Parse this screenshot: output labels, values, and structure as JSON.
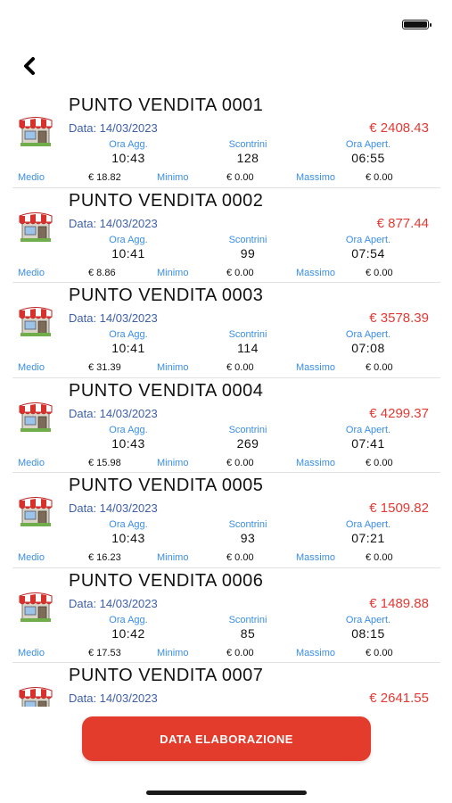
{
  "nav": {
    "back_icon": "chevron-left-icon"
  },
  "status": {
    "battery_icon": "battery-icon"
  },
  "stores": [
    {
      "name": "PUNTO VENDITA 0001",
      "date": "Data: 14/03/2023",
      "total": "€ 2408.43",
      "ora_agg_label": "Ora Agg.",
      "ora_agg": "10:43",
      "scontrini_label": "Scontrini",
      "scontrini": "128",
      "ora_apert_label": "Ora Apert.",
      "ora_apert": "06:55",
      "medio_label": "Medio",
      "medio": "€ 18.82",
      "minimo_label": "Minimo",
      "minimo": "€ 0.00",
      "massimo_label": "Massimo",
      "massimo": "€ 0.00"
    },
    {
      "name": "PUNTO VENDITA 0002",
      "date": "Data: 14/03/2023",
      "total": "€ 877.44",
      "ora_agg_label": "Ora Agg.",
      "ora_agg": "10:41",
      "scontrini_label": "Scontrini",
      "scontrini": "99",
      "ora_apert_label": "Ora Apert.",
      "ora_apert": "07:54",
      "medio_label": "Medio",
      "medio": "€ 8.86",
      "minimo_label": "Minimo",
      "minimo": "€ 0.00",
      "massimo_label": "Massimo",
      "massimo": "€ 0.00"
    },
    {
      "name": "PUNTO VENDITA 0003",
      "date": "Data: 14/03/2023",
      "total": "€ 3578.39",
      "ora_agg_label": "Ora Agg.",
      "ora_agg": "10:41",
      "scontrini_label": "Scontrini",
      "scontrini": "114",
      "ora_apert_label": "Ora Apert.",
      "ora_apert": "07:08",
      "medio_label": "Medio",
      "medio": "€ 31.39",
      "minimo_label": "Minimo",
      "minimo": "€ 0.00",
      "massimo_label": "Massimo",
      "massimo": "€ 0.00"
    },
    {
      "name": "PUNTO VENDITA 0004",
      "date": "Data: 14/03/2023",
      "total": "€ 4299.37",
      "ora_agg_label": "Ora Agg.",
      "ora_agg": "10:43",
      "scontrini_label": "Scontrini",
      "scontrini": "269",
      "ora_apert_label": "Ora Apert.",
      "ora_apert": "07:41",
      "medio_label": "Medio",
      "medio": "€ 15.98",
      "minimo_label": "Minimo",
      "minimo": "€ 0.00",
      "massimo_label": "Massimo",
      "massimo": "€ 0.00"
    },
    {
      "name": "PUNTO VENDITA 0005",
      "date": "Data: 14/03/2023",
      "total": "€ 1509.82",
      "ora_agg_label": "Ora Agg.",
      "ora_agg": "10:43",
      "scontrini_label": "Scontrini",
      "scontrini": "93",
      "ora_apert_label": "Ora Apert.",
      "ora_apert": "07:21",
      "medio_label": "Medio",
      "medio": "€ 16.23",
      "minimo_label": "Minimo",
      "minimo": "€ 0.00",
      "massimo_label": "Massimo",
      "massimo": "€ 0.00"
    },
    {
      "name": "PUNTO VENDITA 0006",
      "date": "Data: 14/03/2023",
      "total": "€ 1489.88",
      "ora_agg_label": "Ora Agg.",
      "ora_agg": "10:42",
      "scontrini_label": "Scontrini",
      "scontrini": "85",
      "ora_apert_label": "Ora Apert.",
      "ora_apert": "08:15",
      "medio_label": "Medio",
      "medio": "€ 17.53",
      "minimo_label": "Minimo",
      "minimo": "€ 0.00",
      "massimo_label": "Massimo",
      "massimo": "€ 0.00"
    },
    {
      "name": "PUNTO VENDITA 0007",
      "date": "Data: 14/03/2023",
      "total": "€ 2641.55",
      "ora_agg_label": "",
      "ora_agg": "",
      "scontrini_label": "",
      "scontrini": "",
      "ora_apert_label": "",
      "ora_apert": "",
      "medio_label": "",
      "medio": "",
      "minimo_label": "",
      "minimo": "",
      "massimo_label": "",
      "massimo": ""
    }
  ],
  "action": {
    "label": "DATA ELABORAZIONE"
  },
  "colors": {
    "accent_red": "#e33c2c",
    "total_red": "#e23a34",
    "label_blue": "#3a8ee6",
    "date_blue": "#3f60a8"
  }
}
